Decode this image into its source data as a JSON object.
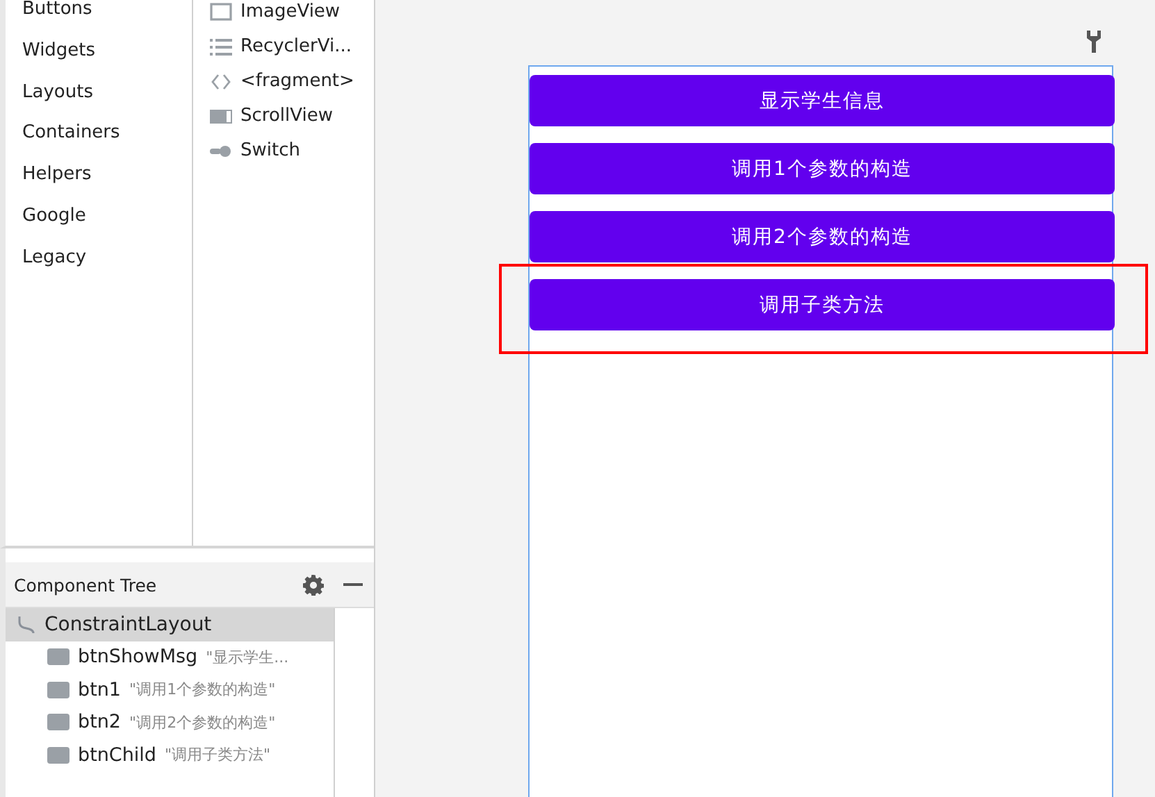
{
  "palette": {
    "categories": [
      {
        "label": "Buttons",
        "selected": false
      },
      {
        "label": "Widgets",
        "selected": false
      },
      {
        "label": "Layouts",
        "selected": false
      },
      {
        "label": "Containers",
        "selected": false
      },
      {
        "label": "Helpers",
        "selected": false
      },
      {
        "label": "Google",
        "selected": false
      },
      {
        "label": "Legacy",
        "selected": false
      }
    ],
    "items": [
      {
        "label": "ImageView",
        "kind": "image"
      },
      {
        "label": "RecyclerVi...",
        "kind": "list"
      },
      {
        "label": "<fragment>",
        "kind": "fragment"
      },
      {
        "label": "ScrollView",
        "kind": "scroll"
      },
      {
        "label": "Switch",
        "kind": "switch"
      }
    ]
  },
  "component_tree": {
    "title": "Component Tree",
    "root": {
      "label": "ConstraintLayout",
      "selected": true,
      "children": [
        {
          "label": "btnShowMsg",
          "text": "\"显示学生...",
          "selected": false
        },
        {
          "label": "btn1",
          "text": "\"调用1个参数的构造\"",
          "selected": false
        },
        {
          "label": "btn2",
          "text": "\"调用2个参数的构造\"",
          "selected": false
        },
        {
          "label": "btnChild",
          "text": "\"调用子类方法\"",
          "selected": false
        }
      ]
    }
  },
  "preview": {
    "buttons": [
      {
        "label": "显示学生信息",
        "highlighted": false
      },
      {
        "label": "调用1个参数的构造",
        "highlighted": false
      },
      {
        "label": "调用2个参数的构造",
        "highlighted": false
      },
      {
        "label": "调用子类方法",
        "highlighted": true
      }
    ]
  }
}
